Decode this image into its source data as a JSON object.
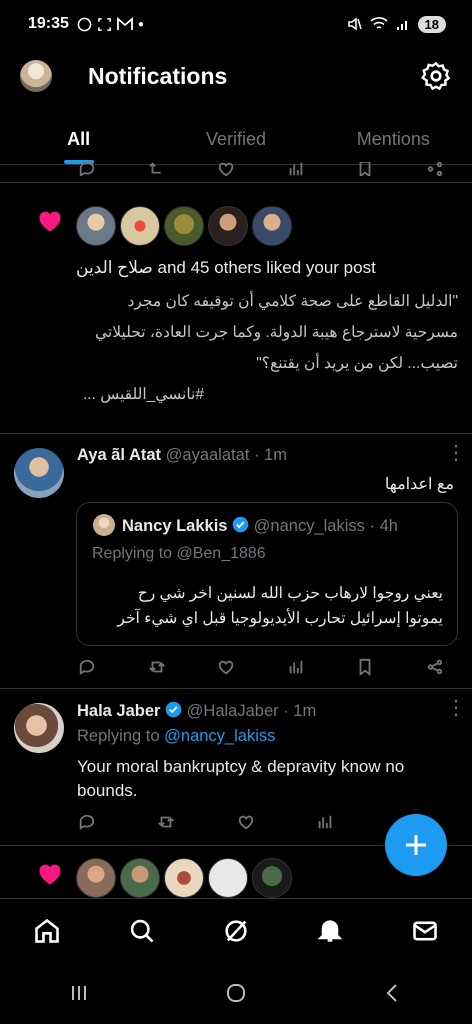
{
  "status": {
    "time": "19:35",
    "battery": "18"
  },
  "header": {
    "title": "Notifications"
  },
  "tabs": [
    {
      "label": "All"
    },
    {
      "label": "Verified"
    },
    {
      "label": "Mentions"
    }
  ],
  "likes1": {
    "text": "صلاح الدين and 45 others liked your post",
    "lines": [
      "\"الدليل القاطع على صحة كلامي أن توقيفه كان مجرد",
      "مسرحية لاسترجاع هيبة الدولة. وكما جرت العادة، تحليلاتي",
      "تصيب... لكن من يريد أن يقتنع؟\"",
      "#نانسي_اللقيس ..."
    ]
  },
  "post1": {
    "name": "Aya ãl Atat",
    "handle": "@ayaalatat",
    "time": "· 1m",
    "text": "مع اعدامها",
    "quote": {
      "name": "Nancy Lakkis",
      "handle": "@nancy_lakiss",
      "time": "· 4h",
      "replying": "Replying to @Ben_1886",
      "lines": [
        "يعني روجوا لارهاب حزب الله لسنين اخر شي رح",
        "يموتوا إسرائيل تحارب الأيديولوجيا قبل اي شيء آخر"
      ]
    }
  },
  "post2": {
    "name": "Hala Jaber",
    "handle": "@HalaJaber",
    "time": "· 1m",
    "replying_prefix": "Replying to ",
    "replying_handle": "@nancy_lakiss",
    "text1": "Your moral bankruptcy & depravity know no",
    "text2": "bounds."
  },
  "colors": {
    "accent": "#1d9bf0",
    "like": "#f91880",
    "bg": "#000000"
  }
}
